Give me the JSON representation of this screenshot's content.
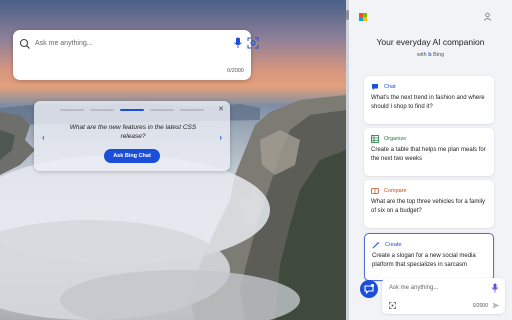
{
  "newtab": {
    "search": {
      "placeholder": "Ask me anything...",
      "char_count": "0/2000"
    },
    "promo": {
      "question": "What are the new features in the latest CSS release?",
      "button_label": "Ask Bing Chat",
      "close_glyph": "✕",
      "prev_glyph": "‹",
      "next_glyph": "›",
      "active_slide": 3,
      "slide_count": 5
    }
  },
  "sidebar": {
    "title": "Your everyday AI companion",
    "subtitle_prefix": "with",
    "subtitle_brand": "Bing",
    "cards": [
      {
        "category": "Chat",
        "category_color": "#1b4fd9",
        "icon": "chat-bubble-icon",
        "prompt": "What's the next trend in fashion and where should I shop to find it?"
      },
      {
        "category": "Organize",
        "category_color": "#1f7a3f",
        "icon": "table-grid-icon",
        "prompt": "Create a table that helps me plan meals for the next two weeks"
      },
      {
        "category": "Compare",
        "category_color": "#c0501c",
        "icon": "compare-icon",
        "prompt": "What are the top three vehicles for a family of six on a budget?"
      },
      {
        "category": "Create",
        "category_color": "#1b4fd9",
        "icon": "magic-wand-icon",
        "prompt": "Create a slogan for a new social media platform that specializes in sarcasm"
      }
    ],
    "composer": {
      "placeholder": "Ask me anything...",
      "char_count": "0/2000"
    }
  },
  "colors": {
    "accent": "#1b4fd9",
    "logo": [
      "#f25022",
      "#7fba00",
      "#00a4ef",
      "#ffb900"
    ]
  }
}
